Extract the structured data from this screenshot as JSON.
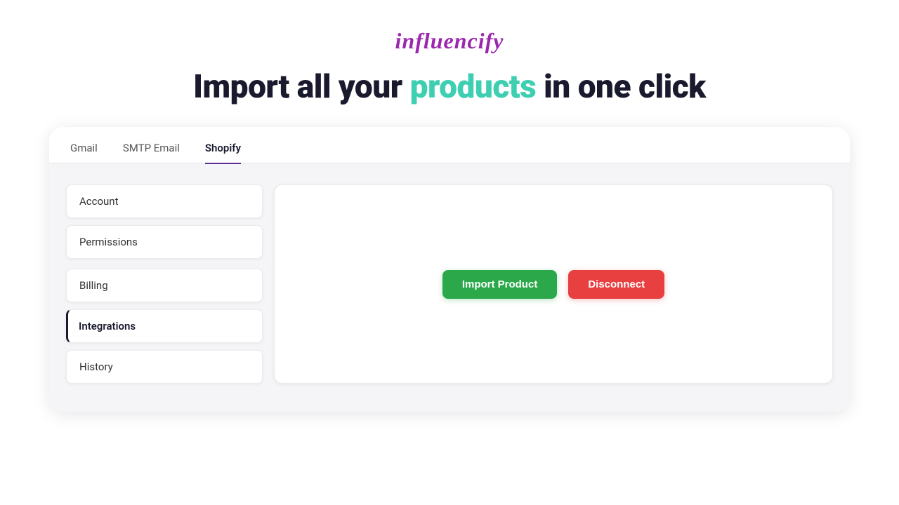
{
  "logo": {
    "text": "influencify"
  },
  "headline": {
    "prefix": "Import all your ",
    "highlight": "products",
    "suffix": " in one click"
  },
  "tabs": [
    {
      "id": "gmail",
      "label": "Gmail",
      "active": false
    },
    {
      "id": "smtp-email",
      "label": "SMTP Email",
      "active": false
    },
    {
      "id": "shopify",
      "label": "Shopify",
      "active": true
    }
  ],
  "sidebar": {
    "items": [
      {
        "id": "account",
        "label": "Account",
        "active": false
      },
      {
        "id": "permissions",
        "label": "Permissions",
        "active": false
      },
      {
        "id": "billing",
        "label": "Billing",
        "active": false
      },
      {
        "id": "integrations",
        "label": "Integrations",
        "active": true
      },
      {
        "id": "history",
        "label": "History",
        "active": false
      }
    ]
  },
  "buttons": {
    "import": "Import Product",
    "disconnect": "Disconnect"
  }
}
